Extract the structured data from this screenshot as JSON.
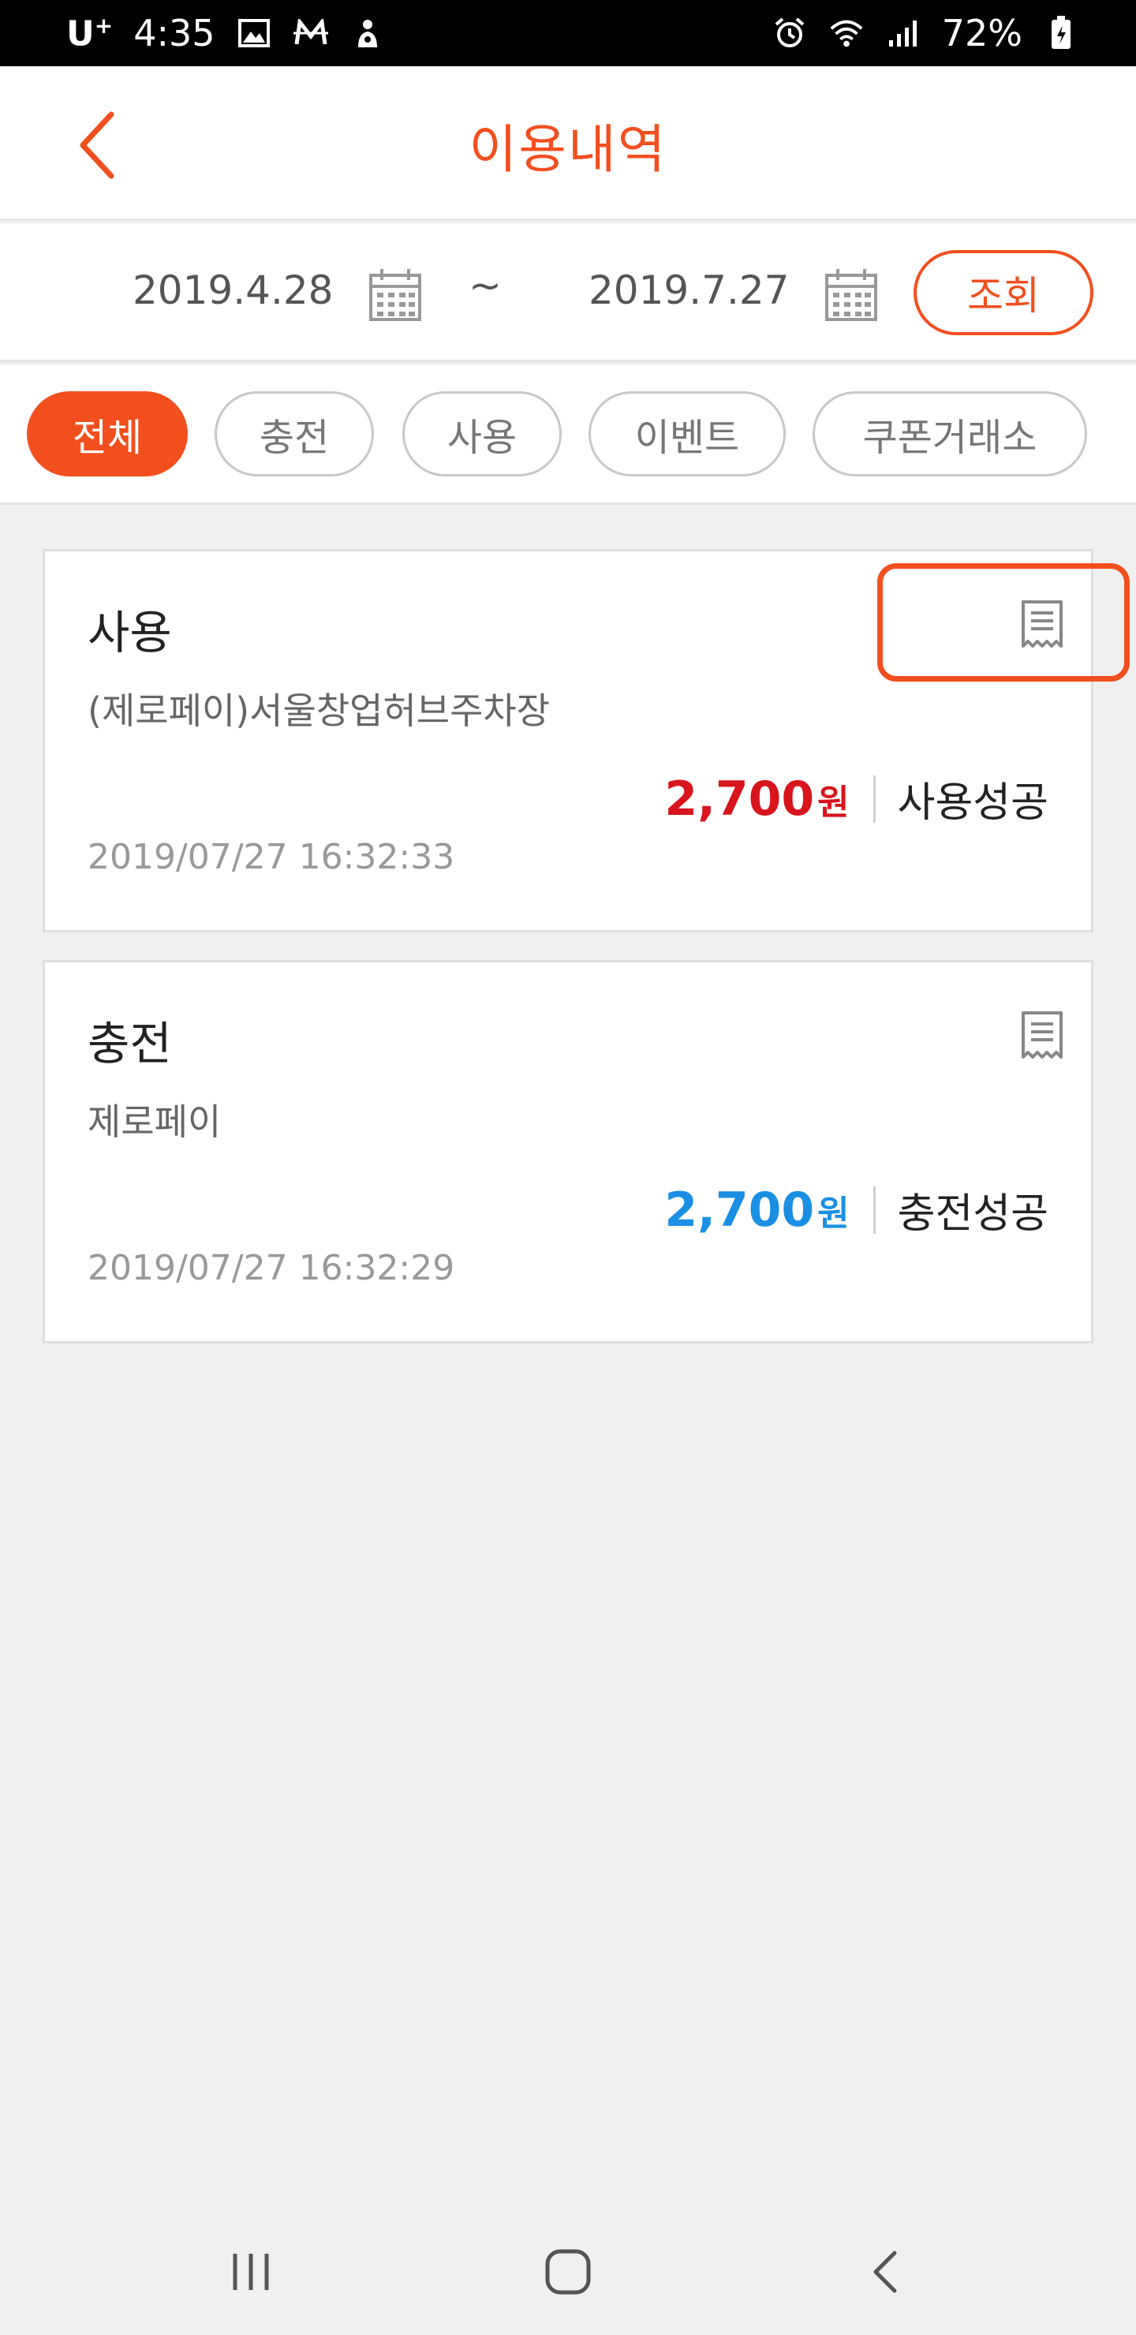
{
  "status_bar": {
    "carrier": "U",
    "carrier_sup": "+",
    "time": "4:35",
    "battery": "72%",
    "left_icons": [
      "image-icon",
      "m-icon",
      "notification-icon"
    ],
    "right_icons": [
      "alarm-icon",
      "wifi-icon",
      "signal-icon",
      "battery-icon"
    ]
  },
  "header": {
    "title": "이용내역",
    "back_icon": "chevron-left-icon"
  },
  "date_range": {
    "start": "2019.4.28",
    "end": "2019.7.27",
    "separator": "~",
    "query_label": "조회"
  },
  "filters": [
    {
      "label": "전체",
      "active": true
    },
    {
      "label": "충전",
      "active": false
    },
    {
      "label": "사용",
      "active": false
    },
    {
      "label": "이벤트",
      "active": false
    },
    {
      "label": "쿠폰거래소",
      "active": false
    }
  ],
  "transactions": [
    {
      "type": "사용",
      "merchant": "(제로페이)서울창업허브주차장",
      "amount": "2,700",
      "unit": "원",
      "status": "사용성공",
      "datetime": "2019/07/27 16:32:33",
      "amount_color": "#d8141c"
    },
    {
      "type": "충전",
      "merchant": "제로페이",
      "amount": "2,700",
      "unit": "원",
      "status": "충전성공",
      "datetime": "2019/07/27 16:32:29",
      "amount_color": "#1a8fe3"
    }
  ],
  "colors": {
    "accent": "#f24f1f",
    "use_amount": "#d8141c",
    "charge_amount": "#1a8fe3"
  }
}
